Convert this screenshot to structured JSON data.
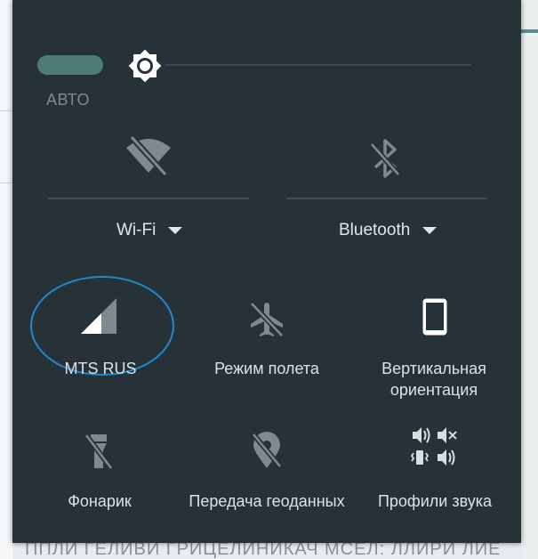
{
  "brightness": {
    "auto_label": "АВТО",
    "level": 0.05
  },
  "toggles": [
    {
      "id": "wifi",
      "label": "Wi-Fi",
      "icon": "wifi-off-icon",
      "enabled": false
    },
    {
      "id": "bluetooth",
      "label": "Bluetooth",
      "icon": "bluetooth-off-icon",
      "enabled": false
    }
  ],
  "tiles": [
    {
      "id": "mobile",
      "label": "MTS RUS",
      "icon": "cellular-signal-icon"
    },
    {
      "id": "airplane",
      "label": "Режим полета",
      "icon": "airplane-icon"
    },
    {
      "id": "rotation",
      "label_line1": "Вертикальная",
      "label_line2": "ориентация",
      "icon": "phone-portrait-icon"
    },
    {
      "id": "flashlight",
      "label": "Фонарик",
      "icon": "flashlight-off-icon"
    },
    {
      "id": "location",
      "label": "Передача геоданных",
      "icon": "location-off-icon"
    },
    {
      "id": "sound",
      "label": "Профили звука",
      "icon": "sound-profiles-icon"
    }
  ],
  "background_text": "ППЛИ ГЕЛИВИ ГРИЦЕЛИНИКАЧ МСЕЛ: ЛЛИРИ ЛИЕ",
  "colors": {
    "panel": "#263238",
    "accent": "#4e7a77",
    "highlight": "#1d8ad0"
  }
}
